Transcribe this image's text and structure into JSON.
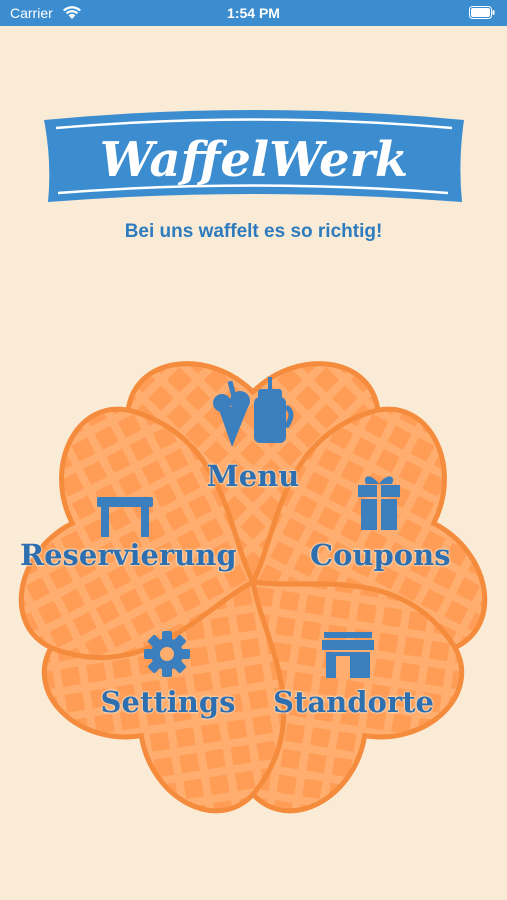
{
  "status_bar": {
    "carrier": "Carrier",
    "time": "1:54 PM"
  },
  "logo": {
    "text": "WaffelWerk"
  },
  "tagline": "Bei uns waffelt es so richtig!",
  "menu": {
    "menu": "Menu",
    "reservierung": "Reservierung",
    "coupons": "Coupons",
    "settings": "Settings",
    "standorte": "Standorte"
  },
  "colors": {
    "brand_blue": "#3B8DD0",
    "waffle_orange": "#FFAA66",
    "background": "#FAEBD6"
  }
}
